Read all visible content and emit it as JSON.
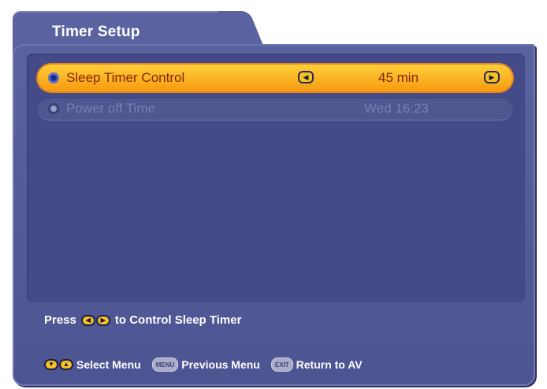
{
  "window": {
    "title": "Timer Setup"
  },
  "menu": {
    "items": [
      {
        "label": "Sleep Timer Control",
        "value": "45 min",
        "state": "selected"
      },
      {
        "label": "Power off Time",
        "value": "Wed 16:23",
        "state": "disabled"
      }
    ]
  },
  "hint": {
    "prefix": "Press",
    "suffix": "to Control Sleep Timer",
    "icons": [
      "left-arrow-key-icon",
      "right-arrow-key-icon"
    ]
  },
  "footer": {
    "select_label": "Select Menu",
    "menu_key": "MENU",
    "previous_label": "Previous Menu",
    "exit_key": "EXIT",
    "exit_label": "Return to AV"
  },
  "colors": {
    "panel": "#5b639f",
    "content_bg": "#444b88",
    "highlight_start": "#ffcf3a",
    "highlight_end": "#f79a10",
    "selected_text": "#8a2400",
    "disabled_text": "#7980b5"
  }
}
